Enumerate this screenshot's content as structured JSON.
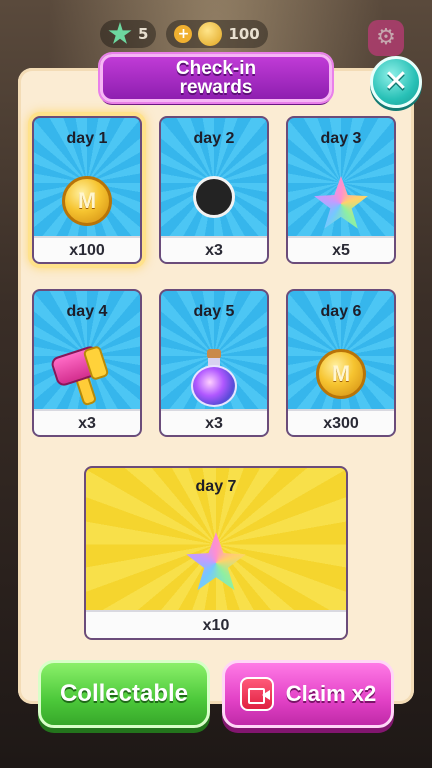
{
  "topbar": {
    "stars": "5",
    "coins": "100"
  },
  "dialog": {
    "title": "Check-in\nrewards"
  },
  "rewards": [
    {
      "day": "day 1",
      "qty": "x100",
      "item": "coin",
      "today": true
    },
    {
      "day": "day 2",
      "qty": "x3",
      "item": "hole"
    },
    {
      "day": "day 3",
      "qty": "x5",
      "item": "rainbow-star"
    },
    {
      "day": "day 4",
      "qty": "x3",
      "item": "hammer"
    },
    {
      "day": "day 5",
      "qty": "x3",
      "item": "potion"
    },
    {
      "day": "day 6",
      "qty": "x300",
      "item": "coin"
    },
    {
      "day": "day 7",
      "qty": "x10",
      "item": "rainbow-star"
    }
  ],
  "buttons": {
    "collect": "Collectable",
    "claim": "Claim x2"
  },
  "icons": {
    "close": "close-icon",
    "settings": "gear-icon",
    "video": "video-ad-icon",
    "coin": "coin-icon",
    "star": "star-icon"
  },
  "colors": {
    "panel": "#fbecd3",
    "title_banner": "#a92cc6",
    "card_blue": "#3db9ee",
    "card_gold": "#f5d52e",
    "collect_green": "#4cc83a",
    "claim_pink": "#e241c6",
    "close_teal": "#28c0b6"
  }
}
